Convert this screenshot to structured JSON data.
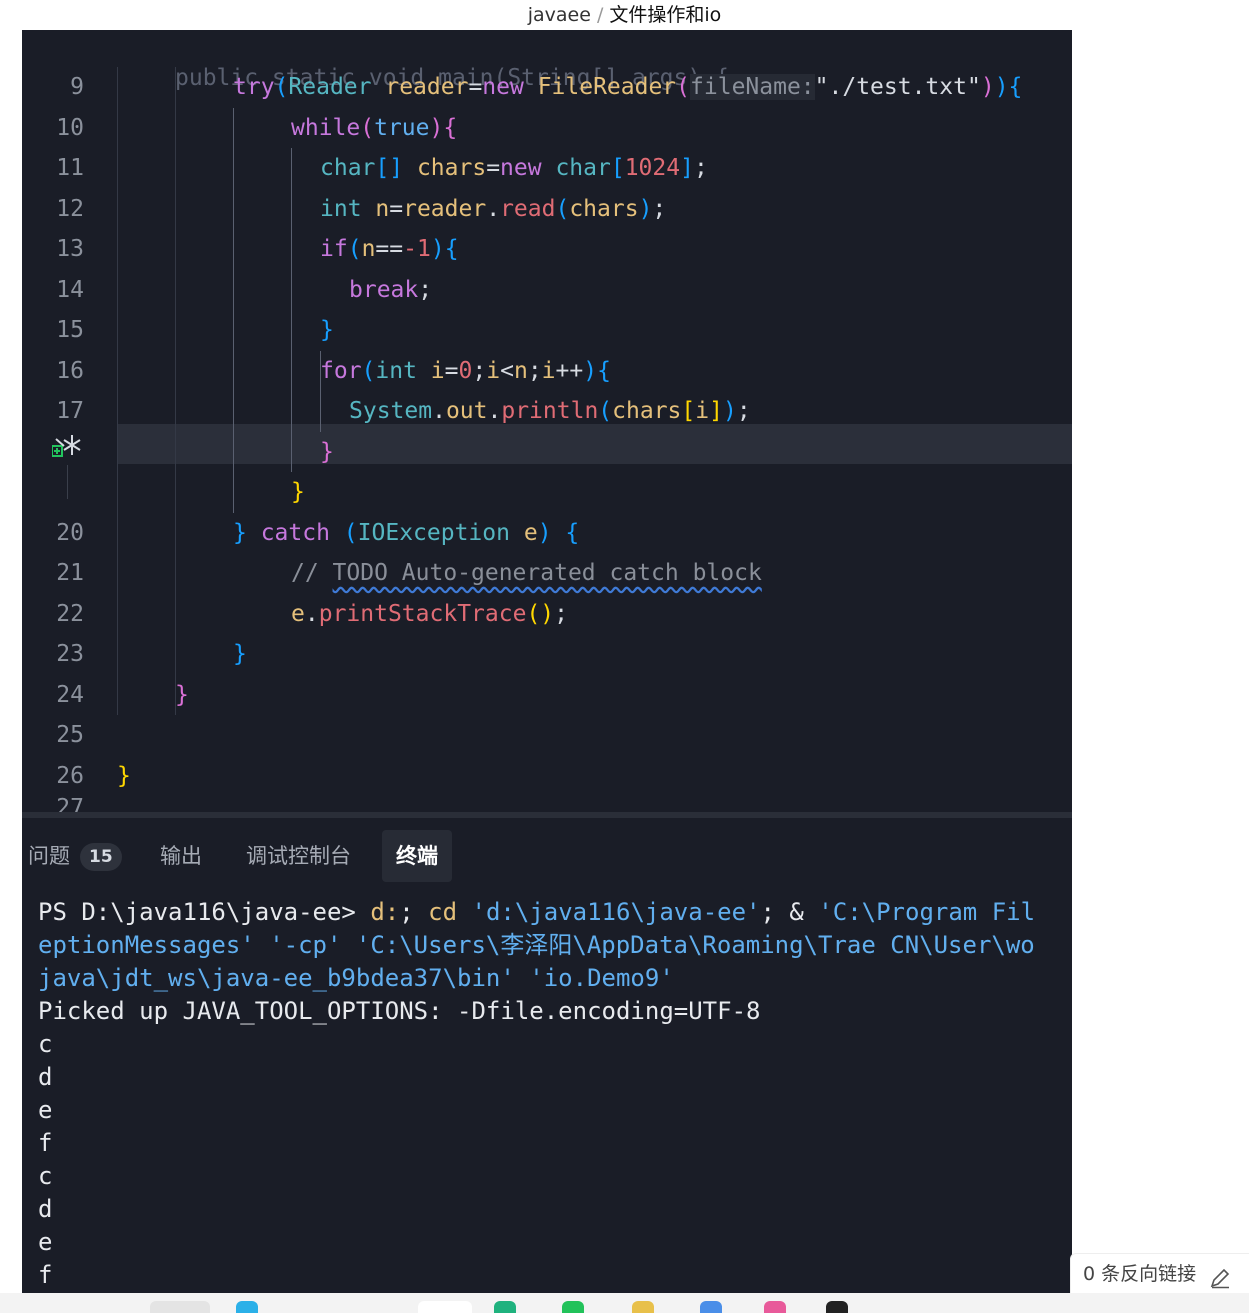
{
  "breadcrumb": {
    "parent": "javaee",
    "separator": "/",
    "current": "文件操作和io"
  },
  "editor": {
    "lines": [
      {
        "num": "9",
        "tokens": [
          [
            "try",
            "k"
          ],
          [
            "(",
            "p3"
          ],
          [
            "Reader ",
            "t"
          ],
          [
            "reader",
            "v"
          ],
          [
            "=",
            "s"
          ],
          [
            "new ",
            "k"
          ],
          [
            "FileReader",
            "f"
          ],
          [
            "(",
            "p2"
          ],
          [
            "fileName:",
            "hint"
          ],
          [
            "\"./test.txt\"",
            "s"
          ],
          [
            ")",
            "p2"
          ],
          [
            ")",
            "p3"
          ],
          [
            "{",
            "p3"
          ]
        ]
      },
      {
        "num": "10",
        "tokens": [
          [
            "while",
            "k"
          ],
          [
            "(",
            "p2"
          ],
          [
            "true",
            "kb"
          ],
          [
            ")",
            "p2"
          ],
          [
            "{",
            "p2"
          ]
        ]
      },
      {
        "num": "11",
        "tokens": [
          [
            "char",
            "t"
          ],
          [
            "[]",
            "p3"
          ],
          [
            " chars",
            "f"
          ],
          [
            "=",
            "s"
          ],
          [
            "new ",
            "k"
          ],
          [
            "char",
            "t"
          ],
          [
            "[",
            "p3"
          ],
          [
            "1024",
            "n"
          ],
          [
            "]",
            "p3"
          ],
          [
            ";",
            "s"
          ]
        ]
      },
      {
        "num": "12",
        "tokens": [
          [
            "int ",
            "t"
          ],
          [
            "n",
            "v"
          ],
          [
            "=",
            "s"
          ],
          [
            "reader",
            "v"
          ],
          [
            ".",
            "s"
          ],
          [
            "read",
            "m"
          ],
          [
            "(",
            "p3"
          ],
          [
            "chars",
            "f"
          ],
          [
            ")",
            "p3"
          ],
          [
            ";",
            "s"
          ]
        ]
      },
      {
        "num": "13",
        "tokens": [
          [
            "if",
            "k"
          ],
          [
            "(",
            "p3"
          ],
          [
            "n",
            "v"
          ],
          [
            "==",
            "s"
          ],
          [
            "-1",
            "n"
          ],
          [
            ")",
            "p3"
          ],
          [
            "{",
            "p3"
          ]
        ]
      },
      {
        "num": "14",
        "tokens": [
          [
            "break",
            "k"
          ],
          [
            ";",
            "s"
          ]
        ]
      },
      {
        "num": "15",
        "tokens": [
          [
            "}",
            "p3"
          ]
        ]
      },
      {
        "num": "16",
        "tokens": [
          [
            "for",
            "k"
          ],
          [
            "(",
            "p3"
          ],
          [
            "int ",
            "t"
          ],
          [
            "i",
            "v"
          ],
          [
            "=",
            "s"
          ],
          [
            "0",
            "n"
          ],
          [
            ";",
            "s"
          ],
          [
            "i",
            "v"
          ],
          [
            "<",
            "s"
          ],
          [
            "n",
            "v"
          ],
          [
            ";",
            "s"
          ],
          [
            "i",
            "v"
          ],
          [
            "++",
            "s"
          ],
          [
            ")",
            "p3"
          ],
          [
            "{",
            "p3"
          ]
        ]
      },
      {
        "num": "17",
        "tokens": [
          [
            "System",
            "t"
          ],
          [
            ".",
            "s"
          ],
          [
            "out",
            "f"
          ],
          [
            ".",
            "s"
          ],
          [
            "println",
            "m"
          ],
          [
            "(",
            "p3"
          ],
          [
            "chars",
            "f"
          ],
          [
            "[",
            "p1"
          ],
          [
            "i",
            "v"
          ],
          [
            "]",
            "p1"
          ],
          [
            ")",
            "p3"
          ],
          [
            ";",
            "s"
          ]
        ]
      },
      {
        "num": "",
        "tokens": [
          [
            "}",
            "p2"
          ]
        ]
      },
      {
        "num": "",
        "tokens": [
          [
            "}",
            "p1"
          ]
        ]
      },
      {
        "num": "20",
        "tokens": [
          [
            "} ",
            "p3"
          ],
          [
            "catch ",
            "k"
          ],
          [
            "(",
            "p3"
          ],
          [
            "IOException ",
            "t"
          ],
          [
            "e",
            "v"
          ],
          [
            ") ",
            "p3"
          ],
          [
            "{",
            "p3"
          ]
        ]
      },
      {
        "num": "21",
        "tokens": [
          [
            "// ",
            "c"
          ],
          [
            "TODO Auto-generated catch block",
            "c squig"
          ]
        ]
      },
      {
        "num": "22",
        "tokens": [
          [
            "e",
            "v"
          ],
          [
            ".",
            "s"
          ],
          [
            "printStackTrace",
            "m"
          ],
          [
            "(",
            "p1"
          ],
          [
            ")",
            "p1"
          ],
          [
            ";",
            "s"
          ]
        ]
      },
      {
        "num": "23",
        "tokens": [
          [
            "}",
            "p3"
          ]
        ]
      },
      {
        "num": "24",
        "tokens": [
          [
            "}",
            "p2"
          ]
        ]
      },
      {
        "num": "25",
        "tokens": []
      },
      {
        "num": "26",
        "tokens": [
          [
            "}",
            "p1"
          ]
        ]
      }
    ]
  },
  "panel": {
    "tabs": [
      {
        "label": "问题",
        "badge": "15"
      },
      {
        "label": "输出"
      },
      {
        "label": "调试控制台"
      },
      {
        "label": "终端"
      }
    ],
    "active_tab": "终端"
  },
  "terminal": {
    "prompt": "PS D:\\java116\\java-ee>",
    "cmd1": " d:",
    "cmd2": "; ",
    "cmd3": "cd",
    "cmd4": " ",
    "cmd5": "'d:\\java116\\java-ee'",
    "cmd6": "; & ",
    "cmd7": "'C:\\Program Fil",
    "wrap1": "eptionMessages' '-cp' 'C:\\Users\\李泽阳\\AppData\\Roaming\\Trae CN\\User\\wo",
    "wrap2": "java\\jdt_ws\\java-ee_b9bdea37\\bin' 'io.Demo9'",
    "output": [
      "Picked up JAVA_TOOL_OPTIONS: -Dfile.encoding=UTF-8",
      "c",
      "d",
      "e",
      "f",
      "c",
      "d",
      "e",
      "f"
    ]
  },
  "footer": {
    "backlinks": "0 条反向链接"
  }
}
